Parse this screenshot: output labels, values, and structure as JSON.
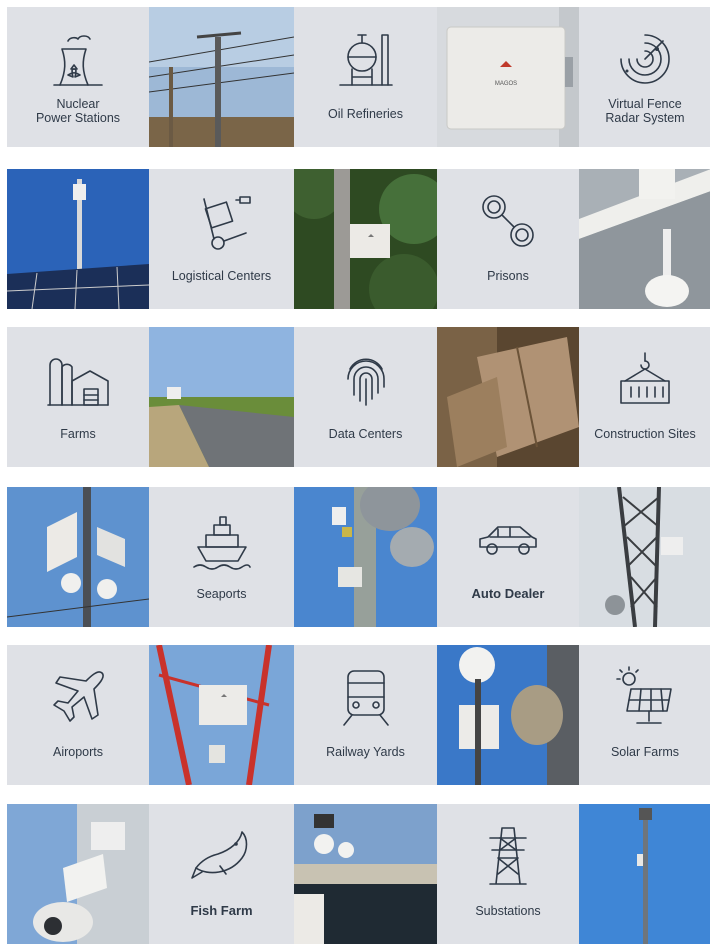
{
  "tiles": {
    "nuclear": "Nuclear\nPower Stations",
    "oil": "Oil Refineries",
    "radar": "Virtual Fence\nRadar System",
    "logistics": "Logistical Centers",
    "prisons": "Prisons",
    "farms": "Farms",
    "datacenters": "Data Centers",
    "construction": "Construction Sites",
    "seaports": "Seaports",
    "autodealer": "Auto Dealer",
    "airports": "Airoports",
    "railway": "Railway Yards",
    "solar": "Solar Farms",
    "fishfarm": "Fish Farm",
    "substations": "Substations"
  },
  "device_brand": "MAGOS",
  "icons": [
    "nuclear-plant-icon",
    "oil-refinery-icon",
    "radar-icon",
    "hand-truck-icon",
    "handcuffs-icon",
    "farm-barn-icon",
    "fingerprint-icon",
    "crane-container-icon",
    "ship-icon",
    "car-icon",
    "airplane-icon",
    "train-icon",
    "solar-panel-icon",
    "fish-icon",
    "power-tower-icon"
  ],
  "colors": {
    "tile_bg": "#dfe1e6",
    "icon_stroke": "#2f3a48",
    "sky": "#4a7fc4",
    "device": "#e8e8e6"
  }
}
